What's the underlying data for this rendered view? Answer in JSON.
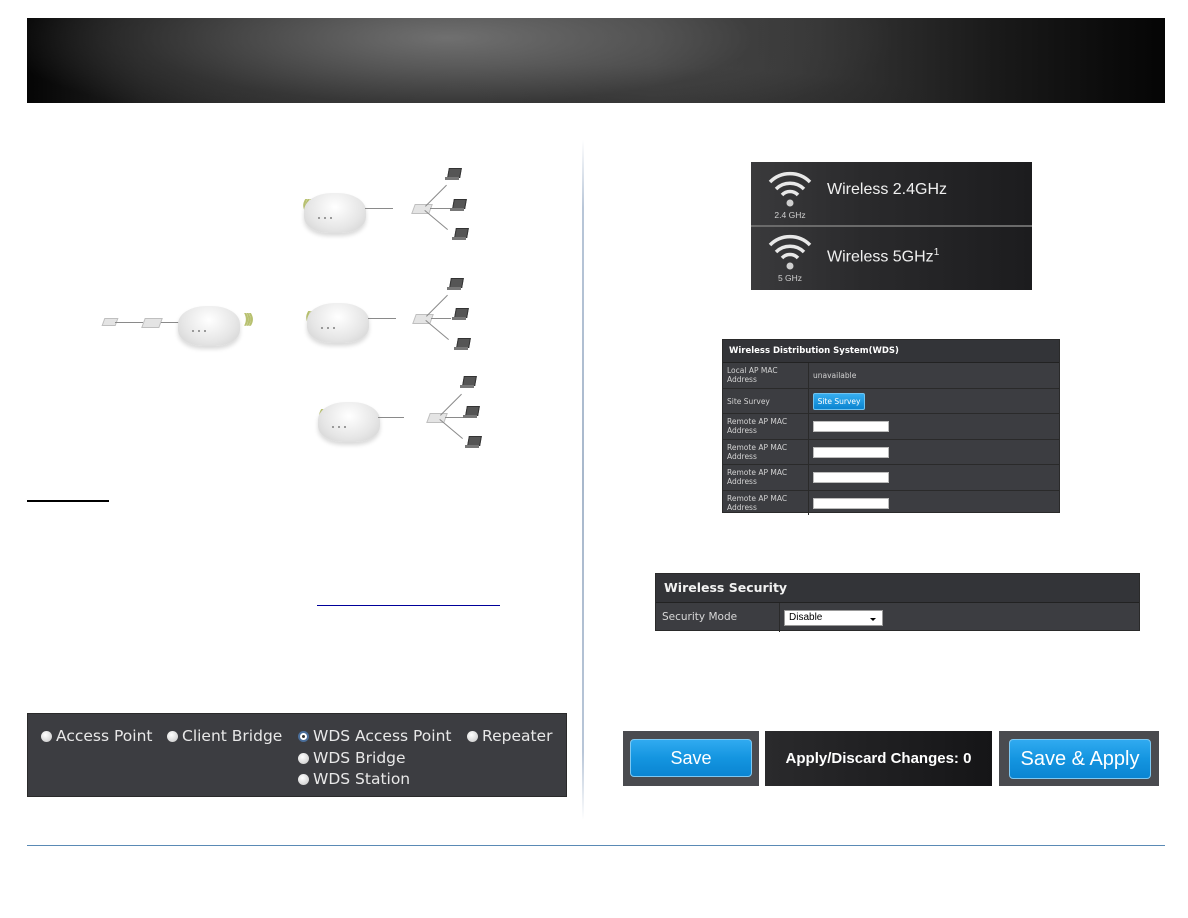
{
  "document": {
    "accent_color": "#5a8ab5",
    "link_color": "#00009a"
  },
  "operation_modes": {
    "options": [
      {
        "label": "Access Point",
        "selected": false
      },
      {
        "label": "Client Bridge",
        "selected": false
      },
      {
        "label": "WDS Access Point",
        "selected": true
      },
      {
        "label": "Repeater",
        "selected": false
      },
      {
        "label": "WDS Bridge",
        "selected": false
      },
      {
        "label": "WDS Station",
        "selected": false
      }
    ]
  },
  "wireless_bands": {
    "items": [
      {
        "icon_label": "2.4 GHz",
        "label": "Wireless 2.4GHz",
        "footnote": ""
      },
      {
        "icon_label": "5 GHz",
        "label": "Wireless 5GHz",
        "footnote": "1"
      }
    ]
  },
  "wds": {
    "title": "Wireless Distribution System(WDS)",
    "rows": [
      {
        "label_line1": "Local AP MAC",
        "label_line2": "Address",
        "value": "unavailable"
      },
      {
        "label": "Site Survey",
        "button": "Site Survey"
      },
      {
        "label_line1": "Remote AP MAC",
        "label_line2": "Address",
        "input_value": ""
      },
      {
        "label_line1": "Remote AP MAC",
        "label_line2": "Address",
        "input_value": ""
      },
      {
        "label_line1": "Remote AP MAC",
        "label_line2": "Address",
        "input_value": ""
      },
      {
        "label_line1": "Remote AP MAC",
        "label_line2": "Address",
        "input_value": ""
      }
    ]
  },
  "security": {
    "title": "Wireless Security",
    "mode_label": "Security Mode",
    "mode_value": "Disable"
  },
  "actions": {
    "save": "Save",
    "apply_discard": "Apply/Discard Changes: 0",
    "save_apply": "Save & Apply"
  }
}
